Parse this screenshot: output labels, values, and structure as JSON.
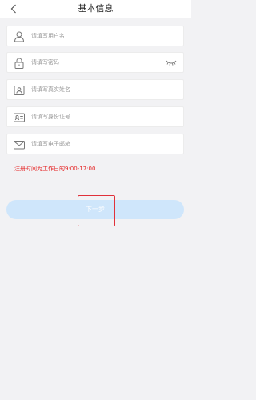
{
  "header": {
    "title": "基本信息",
    "back_icon": "chevron-left-icon"
  },
  "form": {
    "fields": [
      {
        "name": "username",
        "icon": "user-icon",
        "placeholder": "请填写用户名"
      },
      {
        "name": "password",
        "icon": "lock-icon",
        "placeholder": "请填写密码",
        "trailing_icon": "eye-closed-icon"
      },
      {
        "name": "real-name",
        "icon": "name-card-icon",
        "placeholder": "请填写真实姓名"
      },
      {
        "name": "id-card",
        "icon": "id-card-icon",
        "placeholder": "请填写身份证号"
      },
      {
        "name": "email",
        "icon": "mail-icon",
        "placeholder": "请填写电子邮箱"
      }
    ]
  },
  "notice": "注册时间为工作日的9:00-17:00",
  "actions": {
    "next_label": "下一步"
  },
  "colors": {
    "background": "#f2f2f4",
    "notice": "#e52222",
    "button": "#cfe6fb",
    "highlight": "#e0313a"
  }
}
